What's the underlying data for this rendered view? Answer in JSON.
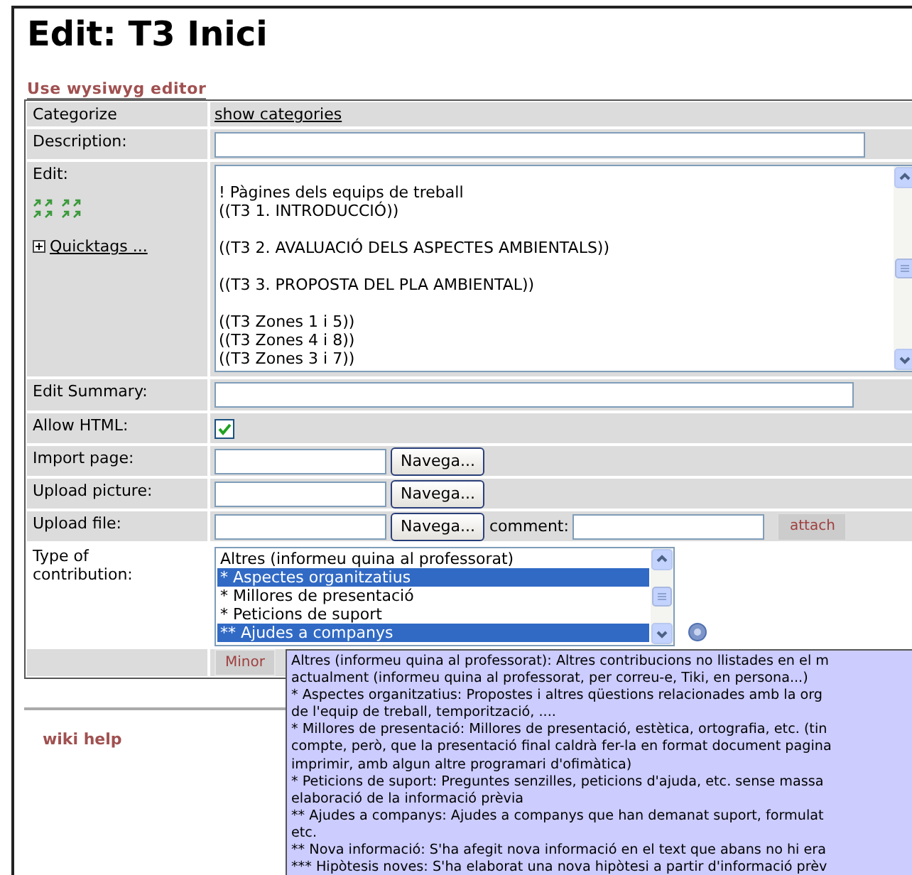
{
  "page": {
    "title": "Edit: T3 Inici",
    "wysiwyg_link": "Use wysiwyg editor"
  },
  "form": {
    "categorize": {
      "label": "Categorize",
      "link": "show categories"
    },
    "description": {
      "label": "Description:"
    },
    "edit": {
      "label": "Edit:",
      "quicktags": "Quicktags ...",
      "paragraphs": [
        [
          "! Pàgines dels equips de treball",
          "((T3 1. INTRODUCCIÓ))"
        ],
        [
          "((T3 2. AVALUACIÓ DELS ASPECTES AMBIENTALS))"
        ],
        [
          "((T3 3. PROPOSTA DEL PLA AMBIENTAL))"
        ],
        [
          "((T3 Zones 1 i 5))",
          "((T3 Zones 4 i 8))",
          "((T3 Zones 3 i 7))"
        ]
      ]
    },
    "edit_summary": {
      "label": "Edit Summary:"
    },
    "allow_html": {
      "label": "Allow HTML:",
      "checked": true
    },
    "import_page": {
      "label": "Import page:",
      "button": "Navega..."
    },
    "upload_picture": {
      "label": "Upload picture:",
      "button": "Navega..."
    },
    "upload_file": {
      "label": "Upload file:",
      "button": "Navega...",
      "comment_label": "comment:",
      "attach": "attach"
    },
    "contribution": {
      "label": "Type of contribution:",
      "options": [
        {
          "label": "Altres (informeu quina al professorat)",
          "selected": false
        },
        {
          "label": "* Aspectes organitzatius",
          "selected": true
        },
        {
          "label": "* Millores de presentació",
          "selected": false
        },
        {
          "label": "* Peticions de suport",
          "selected": false
        },
        {
          "label": "** Ajudes a companys",
          "selected": true
        }
      ]
    },
    "minor_button": "Minor"
  },
  "tooltip": {
    "lines": [
      "Altres (informeu quina al professorat): Altres contribucions no llistades en el m",
      "actualment (informeu quina al professorat, per correu-e, Tiki, en persona...)",
      "* Aspectes organitzatius: Propostes i altres qüestions relacionades amb la org",
      "de l'equip de treball, temporització, ....",
      "* Millores de presentació: Millores de presentació, estètica, ortografia, etc. (tin",
      "compte, però, que la presentació final caldrà fer-la en format document pagina",
      "imprimir, amb algun altre programari d'ofimàtica)",
      "* Peticions de suport: Preguntes senzilles, peticions d'ajuda, etc. sense massa",
      "elaboració de la informació prèvia",
      "** Ajudes a companys: Ajudes a companys que han demanat suport, formulat",
      "etc.",
      "** Nova informació: S'ha afegit nova informació en el text que abans no hi era",
      "*** Hipòtesis noves: S'ha elaborat una nova hipòtesi a partir d'informació prèv"
    ]
  },
  "sidebar": {
    "wiki_help": "wiki help"
  }
}
